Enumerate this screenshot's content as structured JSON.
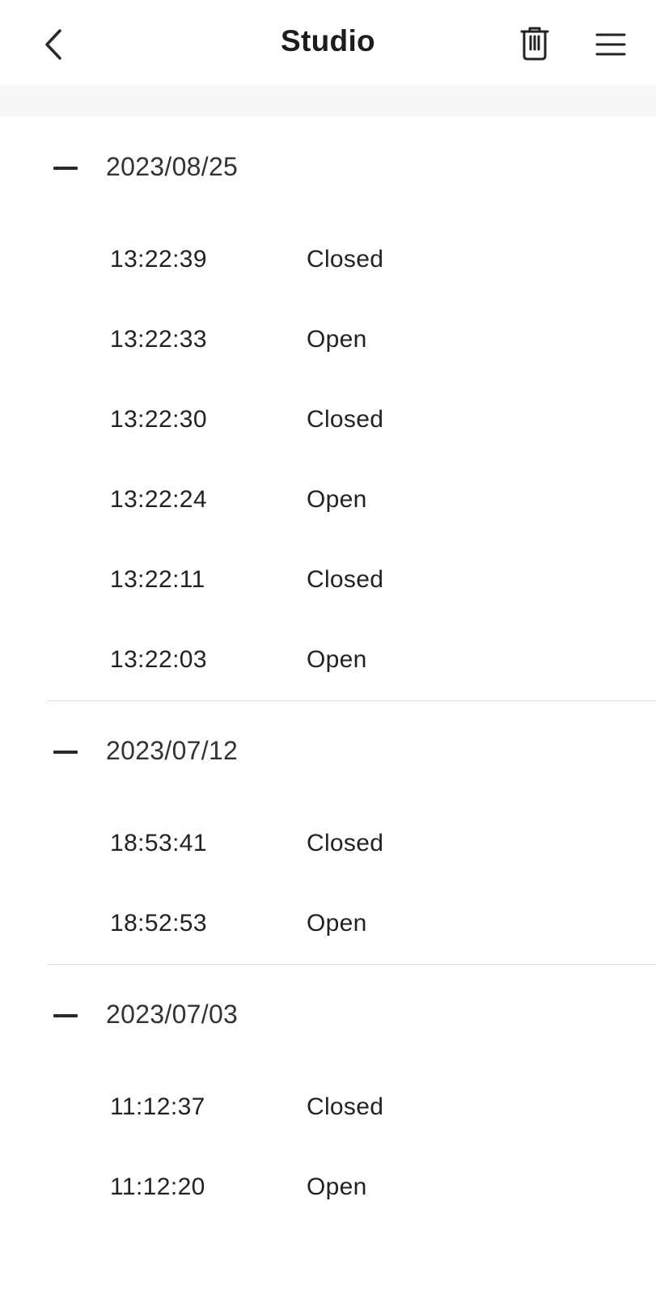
{
  "header": {
    "title": "Studio",
    "back_icon": "chevron-left-icon",
    "delete_icon": "trash-icon",
    "menu_icon": "hamburger-menu-icon"
  },
  "groups": [
    {
      "date": "2023/08/25",
      "collapse_icon": "minus-icon",
      "entries": [
        {
          "time": "13:22:39",
          "status": "Closed"
        },
        {
          "time": "13:22:33",
          "status": "Open"
        },
        {
          "time": "13:22:30",
          "status": "Closed"
        },
        {
          "time": "13:22:24",
          "status": "Open"
        },
        {
          "time": "13:22:11",
          "status": "Closed"
        },
        {
          "time": "13:22:03",
          "status": "Open"
        }
      ]
    },
    {
      "date": "2023/07/12",
      "collapse_icon": "minus-icon",
      "entries": [
        {
          "time": "18:53:41",
          "status": "Closed"
        },
        {
          "time": "18:52:53",
          "status": "Open"
        }
      ]
    },
    {
      "date": "2023/07/03",
      "collapse_icon": "minus-icon",
      "entries": [
        {
          "time": "11:12:37",
          "status": "Closed"
        },
        {
          "time": "11:12:20",
          "status": "Open"
        }
      ]
    }
  ]
}
